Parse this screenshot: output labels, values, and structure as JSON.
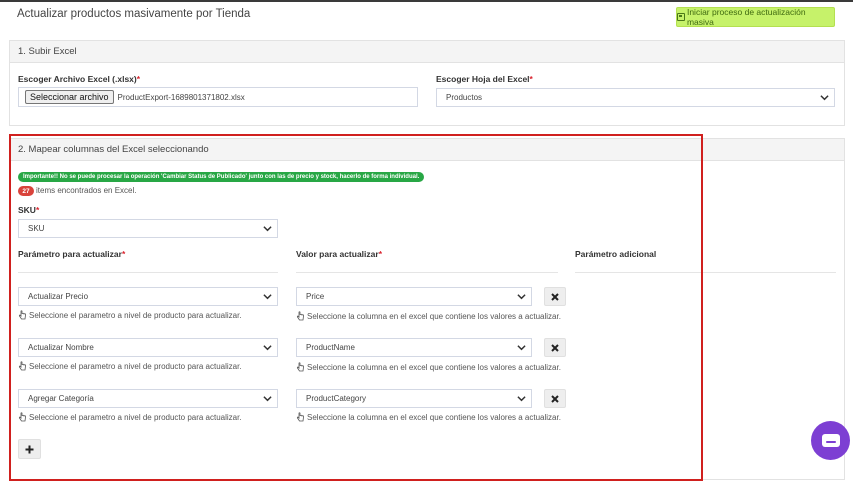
{
  "page": {
    "title": "Actualizar productos masivamente por Tienda",
    "start_button": "Iniciar proceso de actualización masiva"
  },
  "section1": {
    "title": "1. Subir Excel",
    "file_label": "Escoger Archivo Excel (.xlsx)",
    "file_button": "Seleccionar archivo",
    "file_name": "ProductExport-1689801371802.xlsx",
    "sheet_label": "Escoger Hoja del Excel",
    "sheet_value": "Productos"
  },
  "section2": {
    "title": "2. Mapear columnas del Excel seleccionando",
    "alert": "Importante!! No se puede procesar la operación 'Cambiar Status de Publicado' junto con las de precio y stock, hacerlo de forma individual.",
    "items_count": "27",
    "items_text": "items encontrados en Excel.",
    "sku_label": "SKU",
    "sku_value": "SKU",
    "col_param": "Parámetro para actualizar",
    "col_value": "Valor para actualizar",
    "col_extra": "Parámetro adicional",
    "param_help": "Seleccione el parametro a nivel de producto para actualizar.",
    "value_help": "Seleccione la columna en el excel que contiene los valores a actualizar.",
    "rows": [
      {
        "param": "Actualizar Precio",
        "value": "Price"
      },
      {
        "param": "Actualizar Nombre",
        "value": "ProductName"
      },
      {
        "param": "Agregar Categoría",
        "value": "ProductCategory"
      }
    ]
  },
  "colors": {
    "accent_green": "#c6f26a",
    "alert_green": "#28a745",
    "badge_red": "#d9433b",
    "highlight_red": "#d0201e",
    "chat_purple": "#7d3fd3"
  }
}
